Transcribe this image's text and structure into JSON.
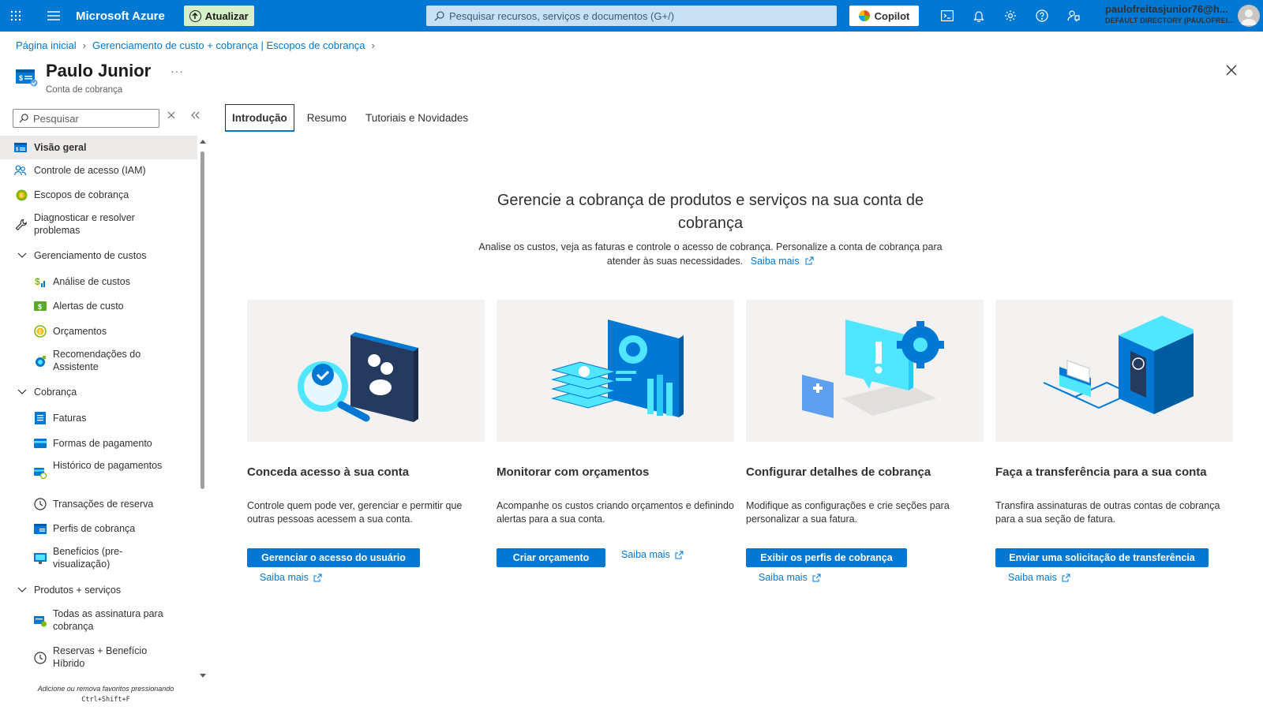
{
  "topbar": {
    "brand": "Microsoft Azure",
    "upgrade_label": "Atualizar",
    "search_placeholder": "Pesquisar recursos, serviços e documentos (G+/)",
    "copilot_label": "Copilot",
    "user_name": "paulofreitasjunior76@h...",
    "user_directory": "DEFAULT DIRECTORY (PAULOFREI..."
  },
  "breadcrumb": [
    "Página inicial",
    "Gerenciamento de custo + cobrança | Escopos de cobrança"
  ],
  "header": {
    "title": "Paulo Junior",
    "subtitle": "Conta de cobrança",
    "more": "···"
  },
  "nav": {
    "search_placeholder": "Pesquisar",
    "items": [
      {
        "label": "Visão geral",
        "icon": "billing-account-icon"
      },
      {
        "label": "Controle de acesso (IAM)",
        "icon": "people-icon"
      },
      {
        "label": "Escopos de cobrança",
        "icon": "scope-icon"
      },
      {
        "label": "Diagnosticar e resolver problemas",
        "icon": "wrench-icon"
      },
      {
        "label": "Gerenciamento de custos",
        "icon": "chevron-down-icon"
      },
      {
        "label": "Análise de custos",
        "icon": "cost-analysis-icon"
      },
      {
        "label": "Alertas de custo",
        "icon": "cost-alert-icon"
      },
      {
        "label": "Orçamentos",
        "icon": "budget-icon"
      },
      {
        "label": "Recomendações do Assistente",
        "icon": "advisor-icon"
      },
      {
        "label": "Cobrança",
        "icon": "chevron-down-icon"
      },
      {
        "label": "Faturas",
        "icon": "invoice-icon"
      },
      {
        "label": "Formas de pagamento",
        "icon": "payment-card-icon"
      },
      {
        "label": "Histórico de pagamentos",
        "icon": "payment-history-icon"
      },
      {
        "label": "Transações de reserva",
        "icon": "clock-icon"
      },
      {
        "label": "Perfis de cobrança",
        "icon": "billing-profile-icon"
      },
      {
        "label": "Benefícios (pre-visualização)",
        "icon": "benefits-icon"
      },
      {
        "label": "Produtos + serviços",
        "icon": "chevron-down-icon"
      },
      {
        "label": "Todas as assinatura para cobrança",
        "icon": "subscription-icon"
      },
      {
        "label": "Reservas + Benefício Híbrido",
        "icon": "reservation-icon"
      }
    ],
    "footer_hint": "Adicione ou remova favoritos pressionando",
    "footer_keys": "Ctrl+Shift+F"
  },
  "tabs": [
    "Introdução",
    "Resumo",
    "Tutoriais e Novidades"
  ],
  "hero": {
    "title": "Gerencie a cobrança de produtos e serviços na sua conta de cobrança",
    "description": "Analise os custos, veja as faturas e controle o acesso de cobrança. Personalize a conta de cobrança para atender às suas necessidades.",
    "learn_more": "Saiba mais"
  },
  "cards": [
    {
      "title": "Conceda acesso à sua conta",
      "description": "Controle quem pode ver, gerenciar e permitir que outras pessoas acessem a sua conta.",
      "button": "Gerenciar o acesso do usuário",
      "link": "Saiba mais"
    },
    {
      "title": "Monitorar com orçamentos",
      "description": "Acompanhe os custos criando orçamentos e definindo alertas para a sua conta.",
      "button": "Criar orçamento",
      "link": "Saiba mais"
    },
    {
      "title": "Configurar detalhes de cobrança",
      "description": "Modifique as configurações e crie seções para personalizar a sua fatura.",
      "button": "Exibir os perfis de cobrança",
      "link": "Saiba mais"
    },
    {
      "title": "Faça a transferência para a sua conta",
      "description": "Transfira assinaturas de outras contas de cobrança para a sua seção de fatura.",
      "button": "Enviar uma solicitação de transferência",
      "link": "Saiba mais"
    }
  ],
  "colors": {
    "accent": "#0078d4",
    "topbar": "#0078d4",
    "upgrade_bg": "#d7f0c9",
    "nav_selected": "#edebe9"
  }
}
